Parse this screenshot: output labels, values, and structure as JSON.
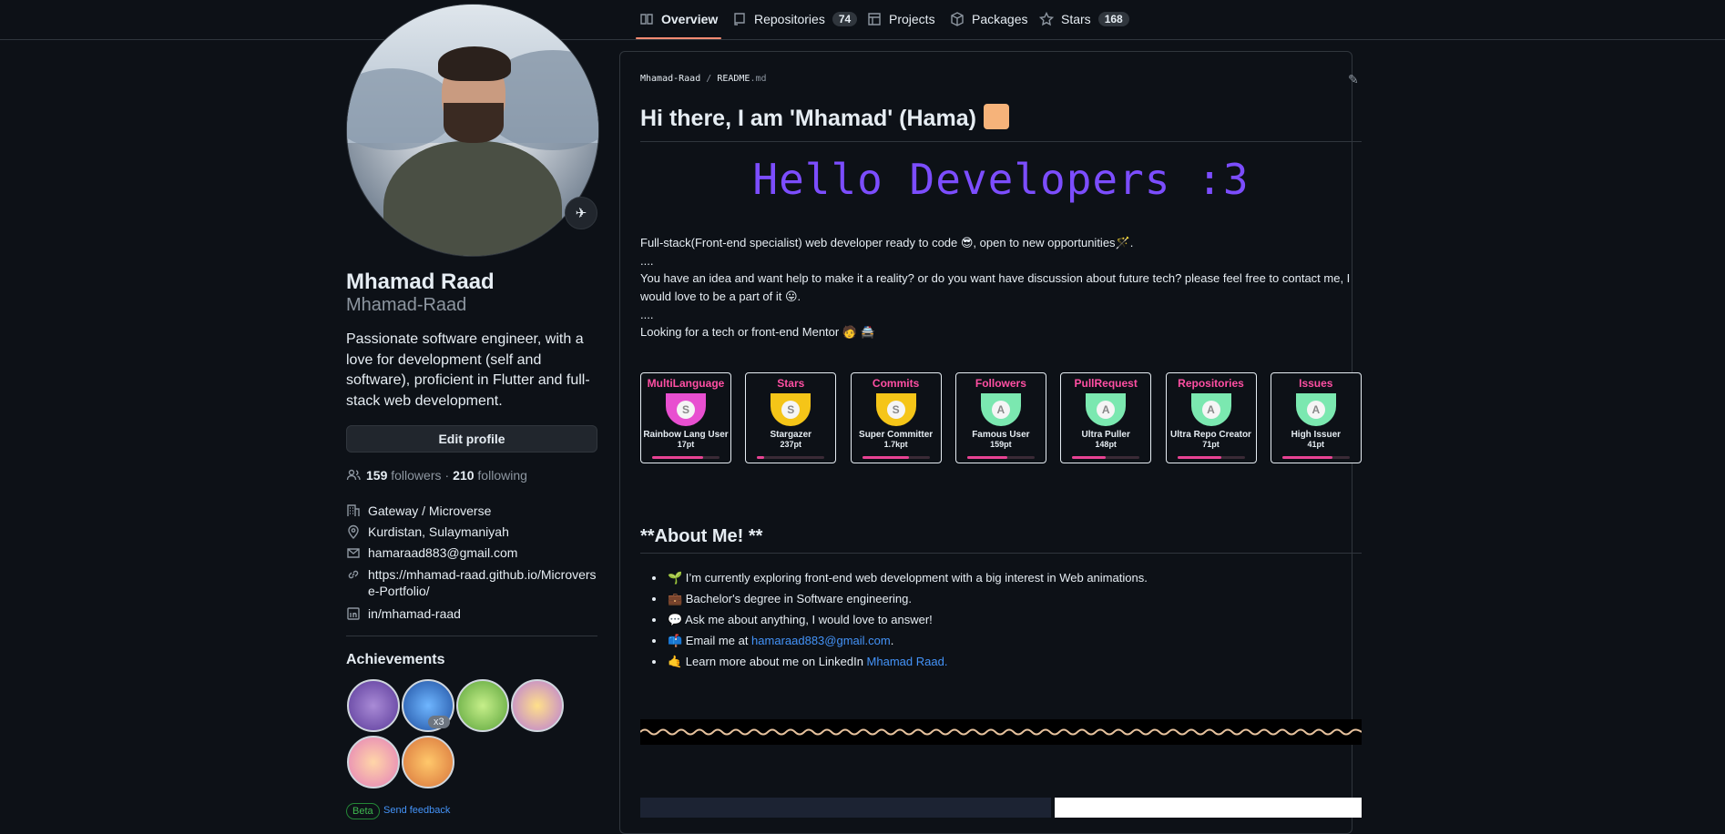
{
  "nav": {
    "tabs": [
      {
        "label": "Overview",
        "icon": "book-icon"
      },
      {
        "label": "Repositories",
        "count": "74",
        "icon": "repo-icon"
      },
      {
        "label": "Projects",
        "icon": "table-icon"
      },
      {
        "label": "Packages",
        "icon": "package-icon"
      },
      {
        "label": "Stars",
        "count": "168",
        "icon": "star-icon"
      }
    ]
  },
  "profile": {
    "name": "Mhamad Raad",
    "login": "Mhamad-Raad",
    "bio": "Passionate software engineer, with a love for development (self and software), proficient in Flutter and full-stack web development.",
    "edit_label": "Edit profile",
    "followers": "159",
    "followers_label": "followers",
    "following": "210",
    "following_label": "following",
    "sep": "·",
    "company": "Gateway / Microverse",
    "location": "Kurdistan, Sulaymaniyah",
    "email": "hamaraad883@gmail.com",
    "website": "https://mhamad-raad.github.io/Microverse-Portfolio/",
    "linkedin": "in/mhamad-raad",
    "achievements_title": "Achievements",
    "achievement_multiplier": "x3",
    "beta": "Beta",
    "feedback": "Send feedback"
  },
  "readme": {
    "owner": "Mhamad-Raad",
    "slash": "/",
    "file": "README",
    "ext": ".md",
    "heading": "Hi there, I am 'Mhamad' (Hama)",
    "hello": "Hello Developers :3",
    "p1": "Full-stack(Front-end specialist) web developer ready to code 😎, open to new opportunities🪄.",
    "dots1": "....",
    "p2": "You have an idea and want help to make it a reality? or do you want have discussion about future tech? please feel free to contact me, I would love to be a part of it 😛.",
    "dots2": "....",
    "p3": "Looking for a tech or front-end Mentor 🧑 🚔",
    "trophies": [
      {
        "title": "MultiLanguage",
        "rank": "S",
        "name": "Rainbow Lang User",
        "pts": "17pt",
        "progress": 0.75
      },
      {
        "title": "Stars",
        "rank": "S",
        "name": "Stargazer",
        "pts": "237pt",
        "progress": 0.1
      },
      {
        "title": "Commits",
        "rank": "S",
        "name": "Super Committer",
        "pts": "1.7kpt",
        "progress": 0.7
      },
      {
        "title": "Followers",
        "rank": "A",
        "name": "Famous User",
        "pts": "159pt",
        "progress": 0.6
      },
      {
        "title": "PullRequest",
        "rank": "A",
        "name": "Ultra Puller",
        "pts": "148pt",
        "progress": 0.5
      },
      {
        "title": "Repositories",
        "rank": "A",
        "name": "Ultra Repo Creator",
        "pts": "71pt",
        "progress": 0.65
      },
      {
        "title": "Issues",
        "rank": "A",
        "name": "High Issuer",
        "pts": "41pt",
        "progress": 0.75
      }
    ],
    "about_title": "**About Me! **",
    "about": [
      {
        "text": "🌱 I’m currently exploring front-end web development with a big interest in Web animations."
      },
      {
        "text": "💼 Bachelor's degree in Software engineering."
      },
      {
        "text": "💬 Ask me about anything, I would love to answer!"
      },
      {
        "text": "📫 Email me at ",
        "link": "hamaraad883@gmail.com",
        "after": "."
      },
      {
        "text": "🤙 Learn more about me on LinkedIn ",
        "link": "Mhamad Raad.",
        "after": ""
      }
    ]
  },
  "colors": {
    "accent": "#fd8c73",
    "link": "#4493f8",
    "hello": "#7c4dff",
    "trophy_title": "#ff4fa3"
  }
}
